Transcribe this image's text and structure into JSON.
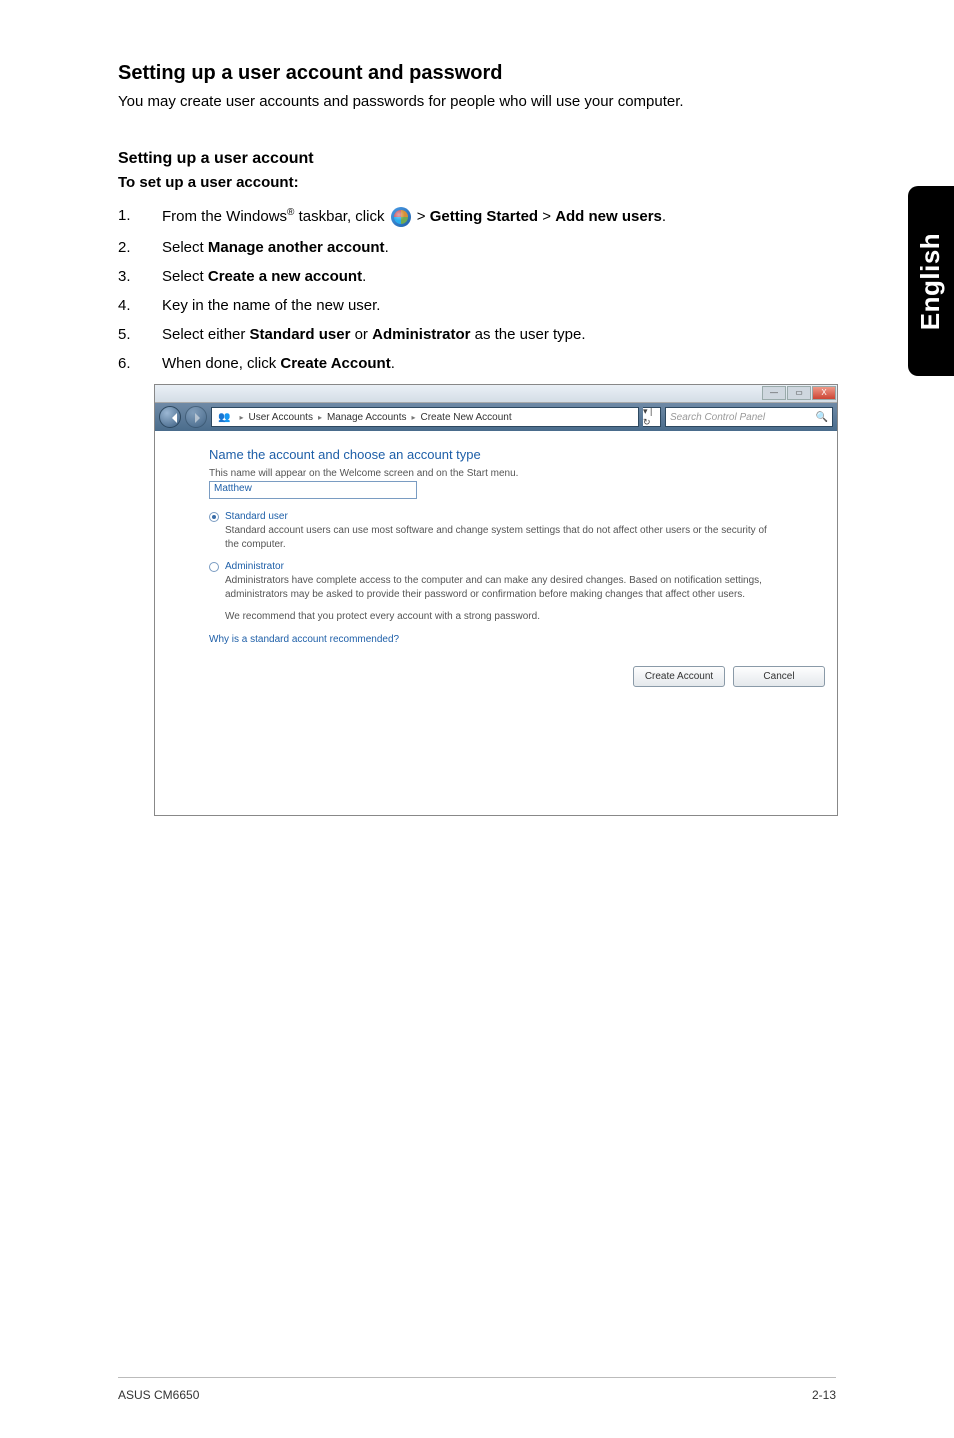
{
  "heading": "Setting up a user account and password",
  "intro": "You may create user accounts and passwords for people who will use your computer.",
  "subheading": "Setting up a user account",
  "procTitle": "To set up a user account:",
  "steps": {
    "s1a": "From the Windows",
    "s1reg": "®",
    "s1b": " taskbar, click ",
    "s1c": " > ",
    "s1gs": "Getting Started",
    "s1gt": " > ",
    "s1an": "Add new users",
    "s1dot": ".",
    "s2a": "Select ",
    "s2b": "Manage another account",
    "s2c": ".",
    "s3a": "Select ",
    "s3b": "Create a new account",
    "s3c": ".",
    "s4": "Key in the name of the new user.",
    "s5a": "Select either ",
    "s5b": "Standard user",
    "s5c": " or ",
    "s5d": "Administrator",
    "s5e": " as the user type.",
    "s6a": "When done, click ",
    "s6b": "Create Account",
    "s6c": "."
  },
  "dialog": {
    "winmin": "—",
    "winmax": "▭",
    "winclose": "X",
    "crumb1": "User Accounts",
    "crumb2": "Manage Accounts",
    "crumb3": "Create New Account",
    "navsep": "▾ | ↻",
    "searchPH": "Search Control Panel",
    "mag": "🔍",
    "h": "Name the account and choose an account type",
    "t1": "This name will appear on the Welcome screen and on the Start menu.",
    "nameVal": "Matthew",
    "r1": "Standard user",
    "r1d": "Standard account users can use most software and change system settings that do not affect other users or the security of the computer.",
    "r2": "Administrator",
    "r2d": "Administrators have complete access to the computer and can make any desired changes. Based on notification settings, administrators may be asked to provide their password or confirmation before making changes that affect other users.",
    "rec": "We recommend that you protect every account with a strong password.",
    "why": "Why is a standard account recommended?",
    "btnCreate": "Create Account",
    "btnCancel": "Cancel"
  },
  "sideTab": "English",
  "footer": {
    "left": "ASUS CM6650",
    "right": "2-13"
  }
}
